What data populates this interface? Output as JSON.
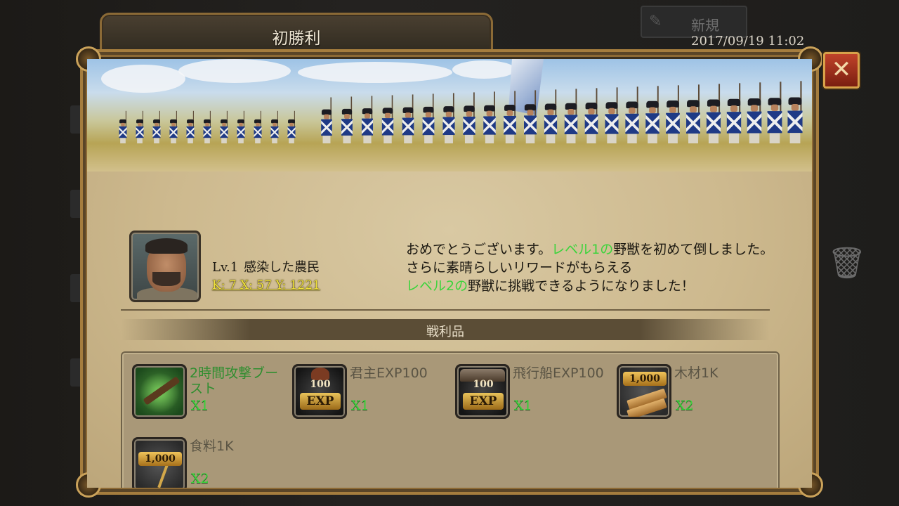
{
  "background": {
    "new_label": "新規",
    "datetime": "2017/09/19 11:02",
    "trash_icon": "trash-icon",
    "pen_icon": "pen-icon"
  },
  "dialog": {
    "title": "初勝利",
    "close_icon": "close-icon"
  },
  "monster": {
    "level": "Lv.1",
    "name": "感染した農民",
    "coords": "K: 7 X: 57 Y: 1221"
  },
  "message": {
    "part1": "おめでとうございます。",
    "hl1": "レベル1の",
    "part2": "野獣を初めて倒しました。さらに素晴らしいリワードがもらえる",
    "hl2": "レベル2の",
    "part3": "野獣に挑戦できるようになりました！"
  },
  "spoils": {
    "title": "戦利品",
    "items": [
      {
        "name": "2時間攻撃ブースト",
        "qty": "X1",
        "icon": "musket-icon",
        "highlight": true
      },
      {
        "name": "君主EXP100",
        "qty": "X1",
        "icon": "lord-exp-icon",
        "badge": "EXP",
        "amount": "100"
      },
      {
        "name": "飛行船EXP100",
        "qty": "X1",
        "icon": "airship-exp-icon",
        "badge": "EXP",
        "amount": "100"
      },
      {
        "name": "木材1K",
        "qty": "X2",
        "icon": "wood-icon",
        "amount": "1,000"
      },
      {
        "name": "食料1K",
        "qty": "X2",
        "icon": "food-icon",
        "amount": "1,000"
      }
    ]
  }
}
